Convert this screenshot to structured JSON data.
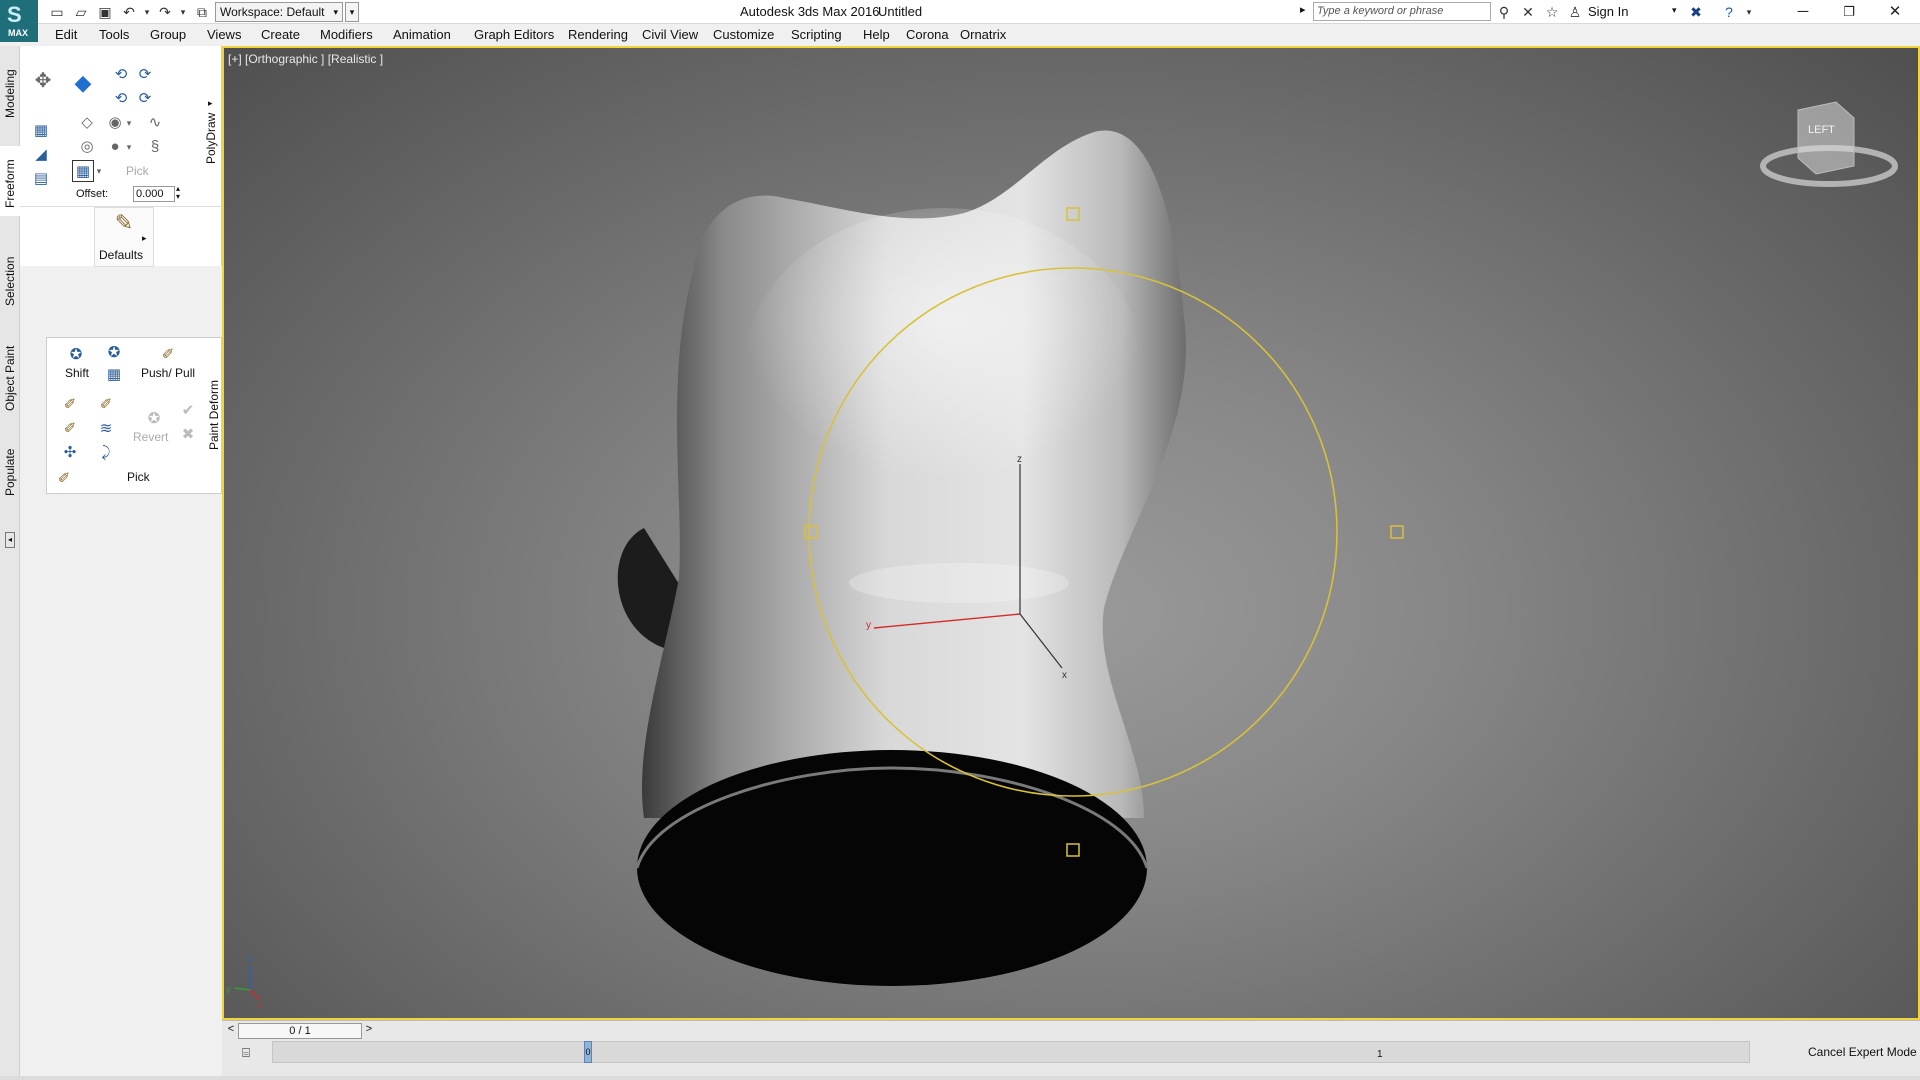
{
  "titlebar": {
    "app_logo_text": "MAX",
    "workspace_label": "Workspace: Default",
    "app_title": "Autodesk 3ds Max 2016",
    "file_name": "Untitled",
    "search_placeholder": "Type a keyword or phrase",
    "sign_in": "Sign In"
  },
  "menu": {
    "items": [
      "Edit",
      "Tools",
      "Group",
      "Views",
      "Create",
      "Modifiers",
      "Animation",
      "Graph Editors",
      "Rendering",
      "Civil View",
      "Customize",
      "Scripting",
      "Help",
      "Corona",
      "Ornatrix"
    ]
  },
  "ribbon_tabs": [
    "Modeling",
    "Freeform",
    "Selection",
    "Object Paint",
    "Populate"
  ],
  "polydraw": {
    "panel_title": "PolyDraw",
    "pick_label": "Pick",
    "offset_label": "Offset:",
    "offset_value": "0.000",
    "defaults_label": "Defaults"
  },
  "paint_deform": {
    "panel_title": "Paint Deform",
    "shift_label": "Shift",
    "push_pull_label": "Push/ Pull",
    "revert_label": "Revert",
    "pick_label": "Pick"
  },
  "viewport": {
    "label": "[+] [Orthographic ] [Realistic ]",
    "viewcube_face": "LEFT",
    "axis_labels": {
      "x": "x",
      "y": "y",
      "z": "z"
    }
  },
  "timeline": {
    "frame_counter": "0 / 1",
    "track_start": "0",
    "track_end": "1"
  },
  "status": {
    "cancel_expert_mode": "Cancel Expert Mode"
  },
  "colors": {
    "viewport_border": "#f3d33c",
    "gizmo_yellow": "#d8c13a",
    "axis_red": "#d32a2a",
    "axis_blue": "#2d5fb8"
  }
}
